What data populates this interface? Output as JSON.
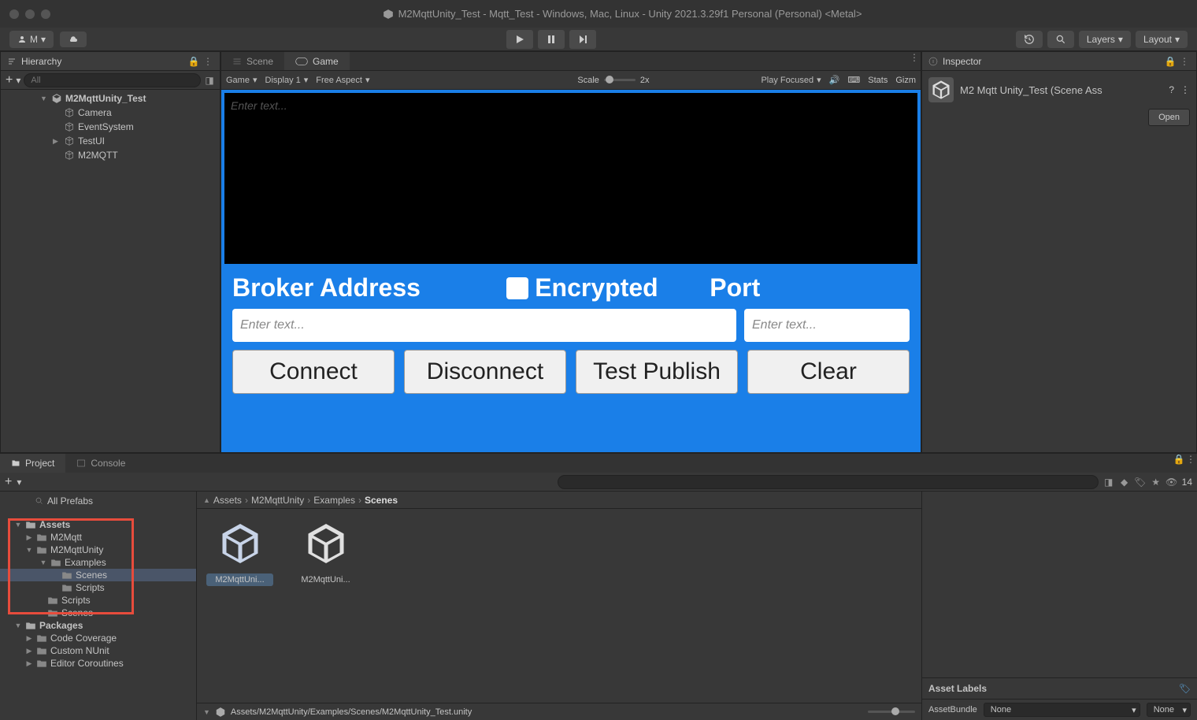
{
  "titlebar": {
    "title": "M2MqttUnity_Test - Mqtt_Test - Windows, Mac, Linux - Unity 2021.3.29f1 Personal (Personal) <Metal>"
  },
  "toolbar": {
    "account": "M",
    "layers": "Layers",
    "layout": "Layout"
  },
  "hierarchy": {
    "title": "Hierarchy",
    "search_placeholder": "All",
    "items": {
      "scene": "M2MqttUnity_Test",
      "camera": "Camera",
      "eventsystem": "EventSystem",
      "testui": "TestUI",
      "m2mqtt": "M2MQTT"
    }
  },
  "tabs": {
    "scene": "Scene",
    "game": "Game"
  },
  "game_toolbar": {
    "game": "Game",
    "display": "Display 1",
    "aspect": "Free Aspect",
    "scale_label": "Scale",
    "scale_value": "2x",
    "play": "Play Focused",
    "stats": "Stats",
    "gizmos": "Gizm"
  },
  "game_ui": {
    "textarea_placeholder": "Enter text...",
    "broker_label": "Broker Address",
    "encrypted_label": "Encrypted",
    "port_label": "Port",
    "input_placeholder": "Enter text...",
    "connect": "Connect",
    "disconnect": "Disconnect",
    "test_publish": "Test Publish",
    "clear": "Clear"
  },
  "inspector": {
    "title": "Inspector",
    "asset_title": "M2 Mqtt Unity_Test (Scene Ass",
    "open": "Open",
    "asset_labels": "Asset Labels",
    "assetbundle": "AssetBundle",
    "none": "None"
  },
  "project": {
    "project_tab": "Project",
    "console_tab": "Console",
    "count": "14",
    "prefabs": "All Prefabs",
    "tree": {
      "assets": "Assets",
      "m2mqtt": "M2Mqtt",
      "m2mqttunity": "M2MqttUnity",
      "examples": "Examples",
      "scenes": "Scenes",
      "scripts": "Scripts",
      "scripts2": "Scripts",
      "scenes2": "Scenes",
      "packages": "Packages",
      "code_coverage": "Code Coverage",
      "custom_nunit": "Custom NUnit",
      "editor_coroutines": "Editor Coroutines"
    },
    "breadcrumb": {
      "assets": "Assets",
      "m2mqttunity": "M2MqttUnity",
      "examples": "Examples",
      "scenes": "Scenes"
    },
    "assets": {
      "item1": "M2MqttUni...",
      "item2": "M2MqttUni..."
    },
    "status_path": "Assets/M2MqttUnity/Examples/Scenes/M2MqttUnity_Test.unity"
  }
}
